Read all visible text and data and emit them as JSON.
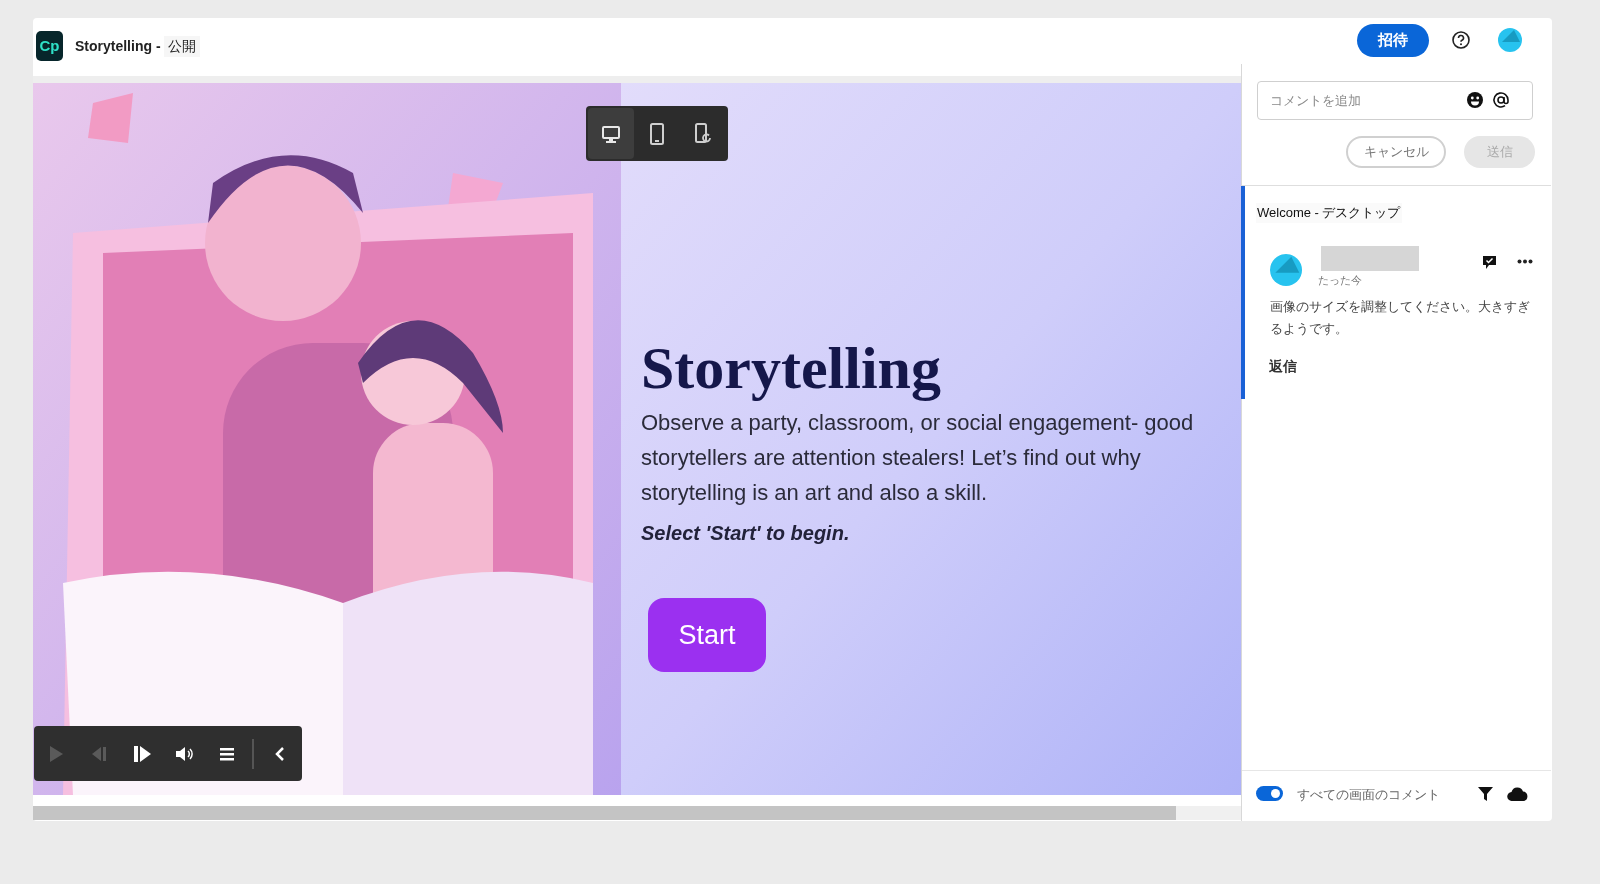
{
  "header": {
    "app_logo": "Cp",
    "title": "Storytelling - ",
    "visibility": "公開",
    "invite_button": "招待"
  },
  "device_toolbar": [
    {
      "kind": "desktop",
      "selected": true
    },
    {
      "kind": "tablet",
      "selected": false
    },
    {
      "kind": "rotate",
      "selected": false
    }
  ],
  "slide": {
    "heading": "Storytelling",
    "body": "Observe a party, classroom, or social engagement- good storytellers are attention stealers! Let’s find out why storytelling is an art and also a skill.",
    "instruction": "Select 'Start' to begin.",
    "start_button": "Start"
  },
  "player_controls": [
    {
      "kind": "play",
      "disabled": true
    },
    {
      "kind": "previous",
      "disabled": true
    },
    {
      "kind": "next",
      "disabled": false
    },
    {
      "kind": "volume",
      "disabled": false
    },
    {
      "kind": "menu",
      "disabled": false
    },
    {
      "kind": "collapse",
      "disabled": false
    }
  ],
  "comments_panel": {
    "comment_field": {
      "placeholder": "コメントを追加"
    },
    "cancel_button": "キャンセル",
    "send_button": {
      "label": "送信",
      "disabled": true
    },
    "thread": {
      "screen_title": "Welcome - デスクトップ",
      "time": "たった今",
      "text": "画像のサイズを調整してください。大きすぎるようです。",
      "reply": "返信"
    },
    "footer": {
      "toggle": {
        "on": true
      },
      "label": "すべての画面のコメント"
    }
  }
}
